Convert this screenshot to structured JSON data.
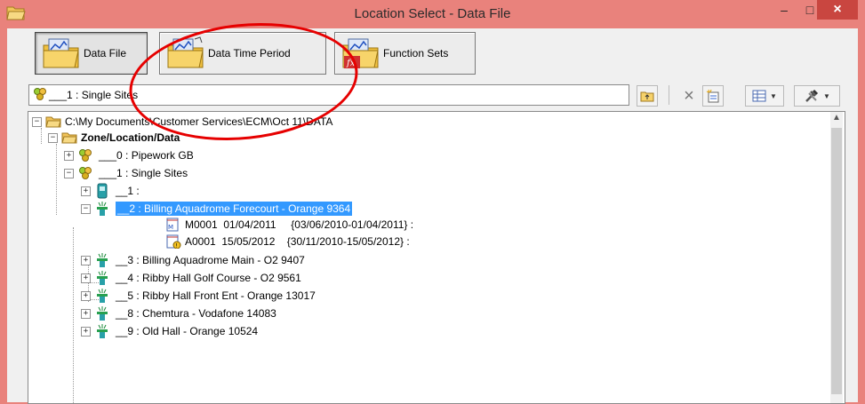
{
  "window": {
    "title": "Location Select - Data File",
    "controls": {
      "minimize": "–",
      "maximize": "□",
      "close": "×"
    }
  },
  "toolbar": {
    "buttons": [
      {
        "label": "Data File",
        "icon": "data-file-icon",
        "pressed": true
      },
      {
        "label": "Data Time Period",
        "icon": "data-time-period-icon",
        "pressed": false
      },
      {
        "label": "Function Sets",
        "icon": "function-sets-icon",
        "pressed": false
      }
    ]
  },
  "path_bar": {
    "value": "___1 : Single Sites",
    "icon": "sites-group-icon"
  },
  "small_toolbar": {
    "up_folder": "up-folder-icon",
    "delete": "×",
    "new": "new-item-icon",
    "view": "view-options-icon",
    "tools": "tools-icon"
  },
  "tree": {
    "root": {
      "label": "C:\\My Documents\\Customer Services\\ECM\\Oct 11\\DATA"
    },
    "zone": {
      "label": "Zone/Location/Data"
    },
    "groups": [
      {
        "label": "___0 : Pipework GB"
      },
      {
        "label": "___1 : Single Sites"
      }
    ],
    "sites": [
      {
        "label": "__1 :"
      },
      {
        "label": "__2 : Billing Aquadrome Forecourt - Orange 9364",
        "selected": true
      },
      {
        "label": "__3 : Billing Aquadrome Main - O2 9407"
      },
      {
        "label": "__4 : Ribby Hall Golf Course - O2 9561"
      },
      {
        "label": "__5 : Ribby Hall Front Ent - Orange 13017"
      },
      {
        "label": "__8 : Chemtura - Vodafone 14083"
      },
      {
        "label": "__9 : Old Hall - Orange 10524"
      }
    ],
    "data_files": [
      {
        "label": "M0001  01/04/2011     {03/06/2010-01/04/2011} :"
      },
      {
        "label": "A0001  15/05/2012    {30/11/2010-15/05/2012} :"
      }
    ]
  },
  "colors": {
    "titlebar": "#e9827c",
    "close_button": "#c94640",
    "selection": "#3399ff",
    "annotation": "#e60000"
  }
}
